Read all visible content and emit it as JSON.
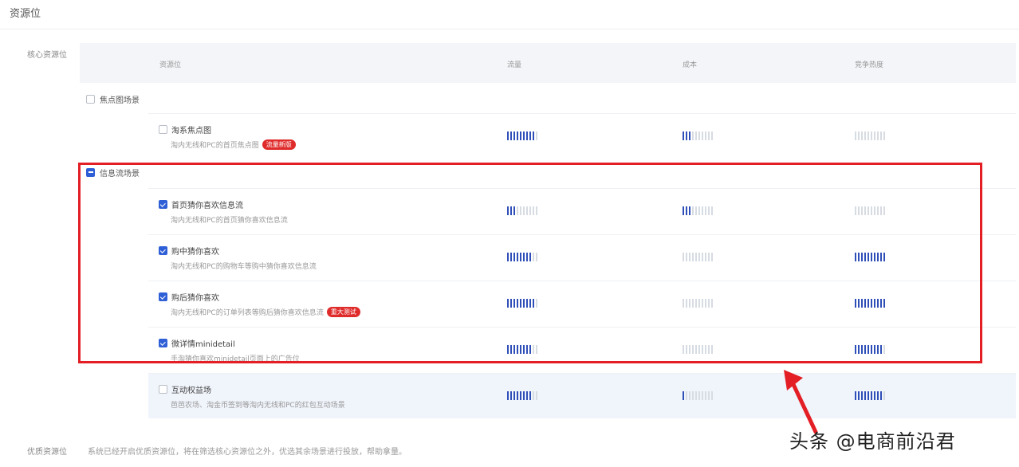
{
  "section_title": "资源位",
  "core_label": "核心资源位",
  "header": {
    "col_name": "资源位",
    "col_traffic": "流量",
    "col_cost": "成本",
    "col_conversion": "竞争热度"
  },
  "groups": [
    {
      "label": "焦点图场景",
      "state": "unchecked"
    },
    {
      "label": "信息流场景",
      "state": "partial"
    }
  ],
  "items": [
    {
      "name": "淘系焦点图",
      "desc": "淘内无线和PC的首页焦点图",
      "badge": "流量新版",
      "checked": false,
      "traffic": 9,
      "cost": 3,
      "heat": 0
    },
    {
      "name": "首页猜你喜欢信息流",
      "desc": "淘内无线和PC的首页猜你喜欢信息流",
      "badge": "",
      "checked": true,
      "traffic": 3,
      "cost": 3,
      "heat": 0
    },
    {
      "name": "购中猜你喜欢",
      "desc": "淘内无线和PC的购物车等购中猜你喜欢信息流",
      "badge": "",
      "checked": true,
      "traffic": 8,
      "cost": 0,
      "heat": 10
    },
    {
      "name": "购后猜你喜欢",
      "desc": "淘内无线和PC的订单列表等购后猜你喜欢信息流",
      "badge": "重大测试",
      "checked": true,
      "traffic": 9,
      "cost": 0,
      "heat": 10
    },
    {
      "name": "微详情minidetail",
      "desc": "手淘猜你喜欢minidetail页面上的广告位",
      "badge": "",
      "checked": true,
      "traffic": 8,
      "cost": 0,
      "heat": 9
    },
    {
      "name": "互动权益场",
      "desc": "芭芭农场、淘金币签到等淘内无线和PC的红包互动场景",
      "badge": "",
      "checked": false,
      "traffic": 8,
      "cost": 1,
      "heat": 9
    }
  ],
  "bottom_label": "优质资源位",
  "bottom_text": "系统已经开启优质资源位，将在筛选核心资源位之外，优选其余场景进行投放，帮助拿量。",
  "watermark": "头条 @电商前沿君",
  "colors": {
    "accent": "#2f5fd6",
    "highlight_border": "#e31e24",
    "badge": "#e02b2b"
  }
}
